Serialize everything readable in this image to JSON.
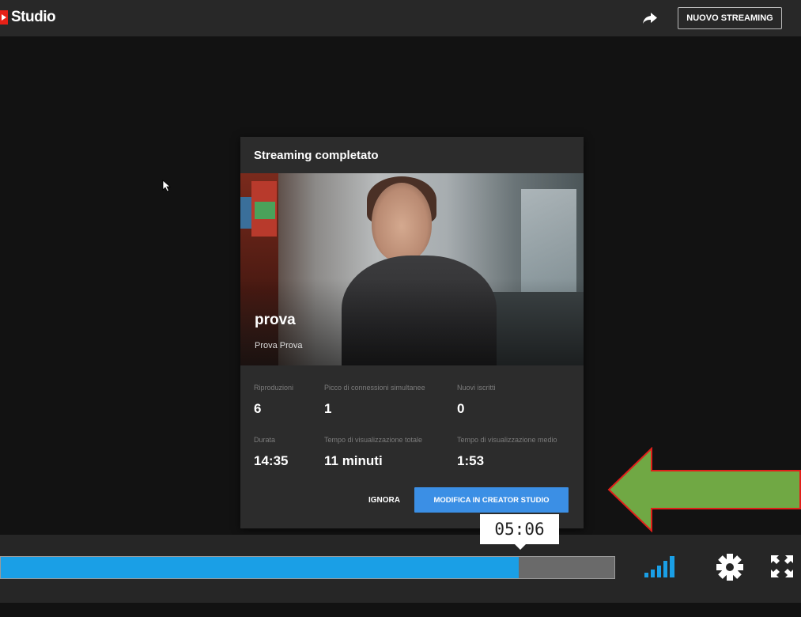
{
  "header": {
    "app_title": "Studio",
    "new_stream_label": "NUOVO STREAMING"
  },
  "modal": {
    "title": "Streaming completato",
    "video_title": "prova",
    "channel_name": "Prova Prova",
    "stats": [
      {
        "label": "Riproduzioni",
        "value": "6"
      },
      {
        "label": "Picco di connessioni simultanee",
        "value": "1"
      },
      {
        "label": "Nuovi iscritti",
        "value": "0"
      },
      {
        "label": "Durata",
        "value": "14:35"
      },
      {
        "label": "Tempo di visualizzazione totale",
        "value": "11 minuti"
      },
      {
        "label": "Tempo di visualizzazione medio",
        "value": "1:53"
      }
    ],
    "ignore_label": "IGNORA",
    "edit_label": "MODIFICA IN CREATOR STUDIO"
  },
  "player": {
    "timestamp": "05:06",
    "progress_fraction": 0.844
  },
  "colors": {
    "accent": "#3b8fe5",
    "progress": "#1a9fe6",
    "annotation_arrow": "#70a844",
    "annotation_border": "#e0201a"
  },
  "icons": [
    "youtube-logo-icon",
    "share-icon",
    "cursor-icon",
    "signal-icon",
    "gear-icon",
    "fullscreen-icon",
    "arrow-annotation-icon"
  ]
}
